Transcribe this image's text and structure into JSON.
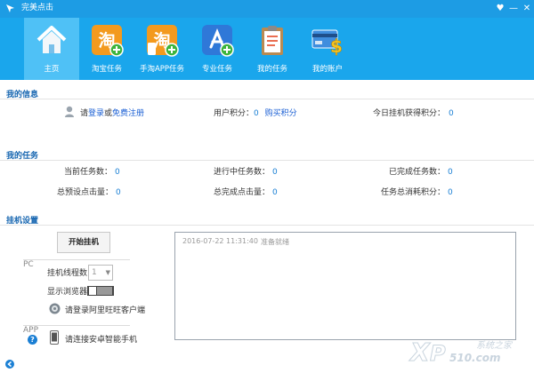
{
  "titlebar": {
    "title": "完美点击",
    "buttons": {
      "menu": "♥",
      "minimize": "—",
      "close": "✕"
    }
  },
  "nav": {
    "items": [
      {
        "label": "主页",
        "icon": "home-icon",
        "active": true
      },
      {
        "label": "淘宝任务",
        "icon": "taobao-task-icon",
        "active": false
      },
      {
        "label": "手淘APP任务",
        "icon": "mobile-taobao-task-icon",
        "active": false
      },
      {
        "label": "专业任务",
        "icon": "app-store-task-icon",
        "active": false
      },
      {
        "label": "我的任务",
        "icon": "clipboard-icon",
        "active": false
      },
      {
        "label": "我的账户",
        "icon": "credit-card-dollar-icon",
        "active": false
      }
    ]
  },
  "my_info": {
    "title": "我的信息",
    "login_prefix": "请",
    "login_link": "登录",
    "login_or": "或",
    "register_link": "免费注册",
    "points_label": "用户积分：",
    "points_value": "0",
    "buy_points": "购买积分",
    "today_label": "今日挂机获得积分：",
    "today_value": "0"
  },
  "my_tasks": {
    "title": "我的任务",
    "stats": [
      {
        "label": "当前任务数：",
        "value": "0"
      },
      {
        "label": "进行中任务数：",
        "value": "0"
      },
      {
        "label": "已完成任务数：",
        "value": "0"
      },
      {
        "label": "总预设点击量：",
        "value": "0"
      },
      {
        "label": "总完成点击量：",
        "value": "0"
      },
      {
        "label": "任务总消耗积分：",
        "value": "0"
      }
    ]
  },
  "hangup": {
    "title": "挂机设置",
    "start_button": "开始挂机",
    "pc_label": "PC",
    "threads_label": "挂机线程数",
    "threads_value": "1",
    "show_browser_label": "显示浏览器",
    "show_browser_on": false,
    "wangwang_text": "请登录阿里旺旺客户端",
    "app_label": "APP",
    "phone_text": "请连接安卓智能手机",
    "log": {
      "time": "2016-07-22 11:31:40",
      "message": "准备就绪"
    }
  },
  "watermark": {
    "text": "系统之家",
    "domain": "510.com"
  },
  "colors": {
    "titlebar": "#1d9ce4",
    "navbar": "#1aa6ec",
    "nav_active": "#4fc1f6",
    "section_title": "#1565b0",
    "value": "#1a7fd4"
  }
}
